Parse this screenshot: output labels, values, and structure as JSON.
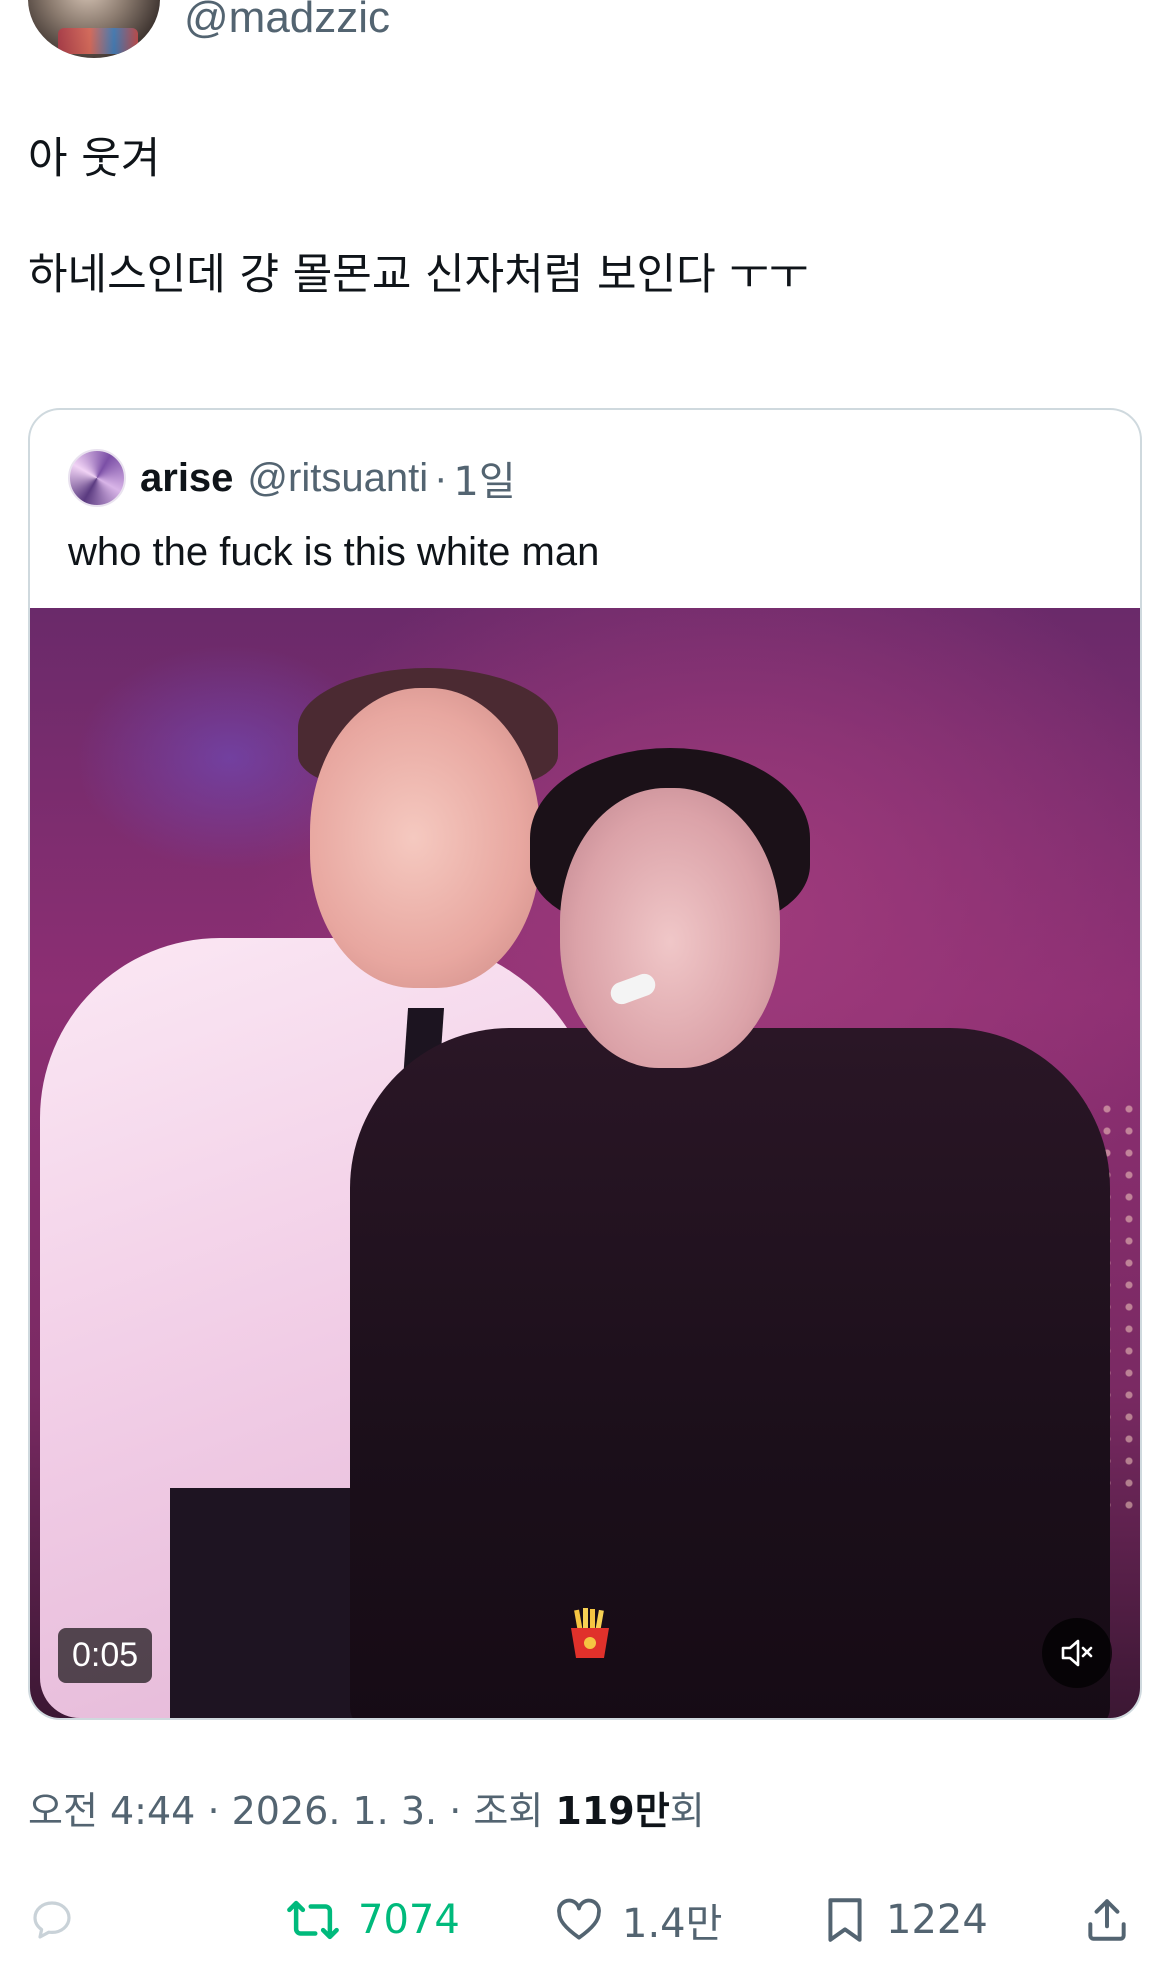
{
  "author": {
    "handle": "@madzzic"
  },
  "tweet": {
    "lines": [
      "아 웃겨",
      "하네스인데 걍 몰몬교 신자처럼 보인다 ㅜㅜ"
    ]
  },
  "quoted": {
    "name": "arise",
    "handle": "@ritsuanti",
    "separator": "·",
    "time": "1일",
    "text": "who the fuck is this white man",
    "media": {
      "duration": "0:05",
      "mute_icon": "volume-muted-icon",
      "emoji_icon": "french-fries-icon"
    }
  },
  "meta": {
    "time": "오전 4:44",
    "date": "2026. 1. 3.",
    "views_prefix": "조회",
    "views_count": "119만",
    "views_suffix": "회",
    "sep": "·"
  },
  "actions": {
    "reply_icon": "reply-icon",
    "retweet_count": "7074",
    "like_count": "1.4만",
    "bookmark_count": "1224",
    "share_icon": "share-icon",
    "accent_retweet": "#00ba7c"
  }
}
